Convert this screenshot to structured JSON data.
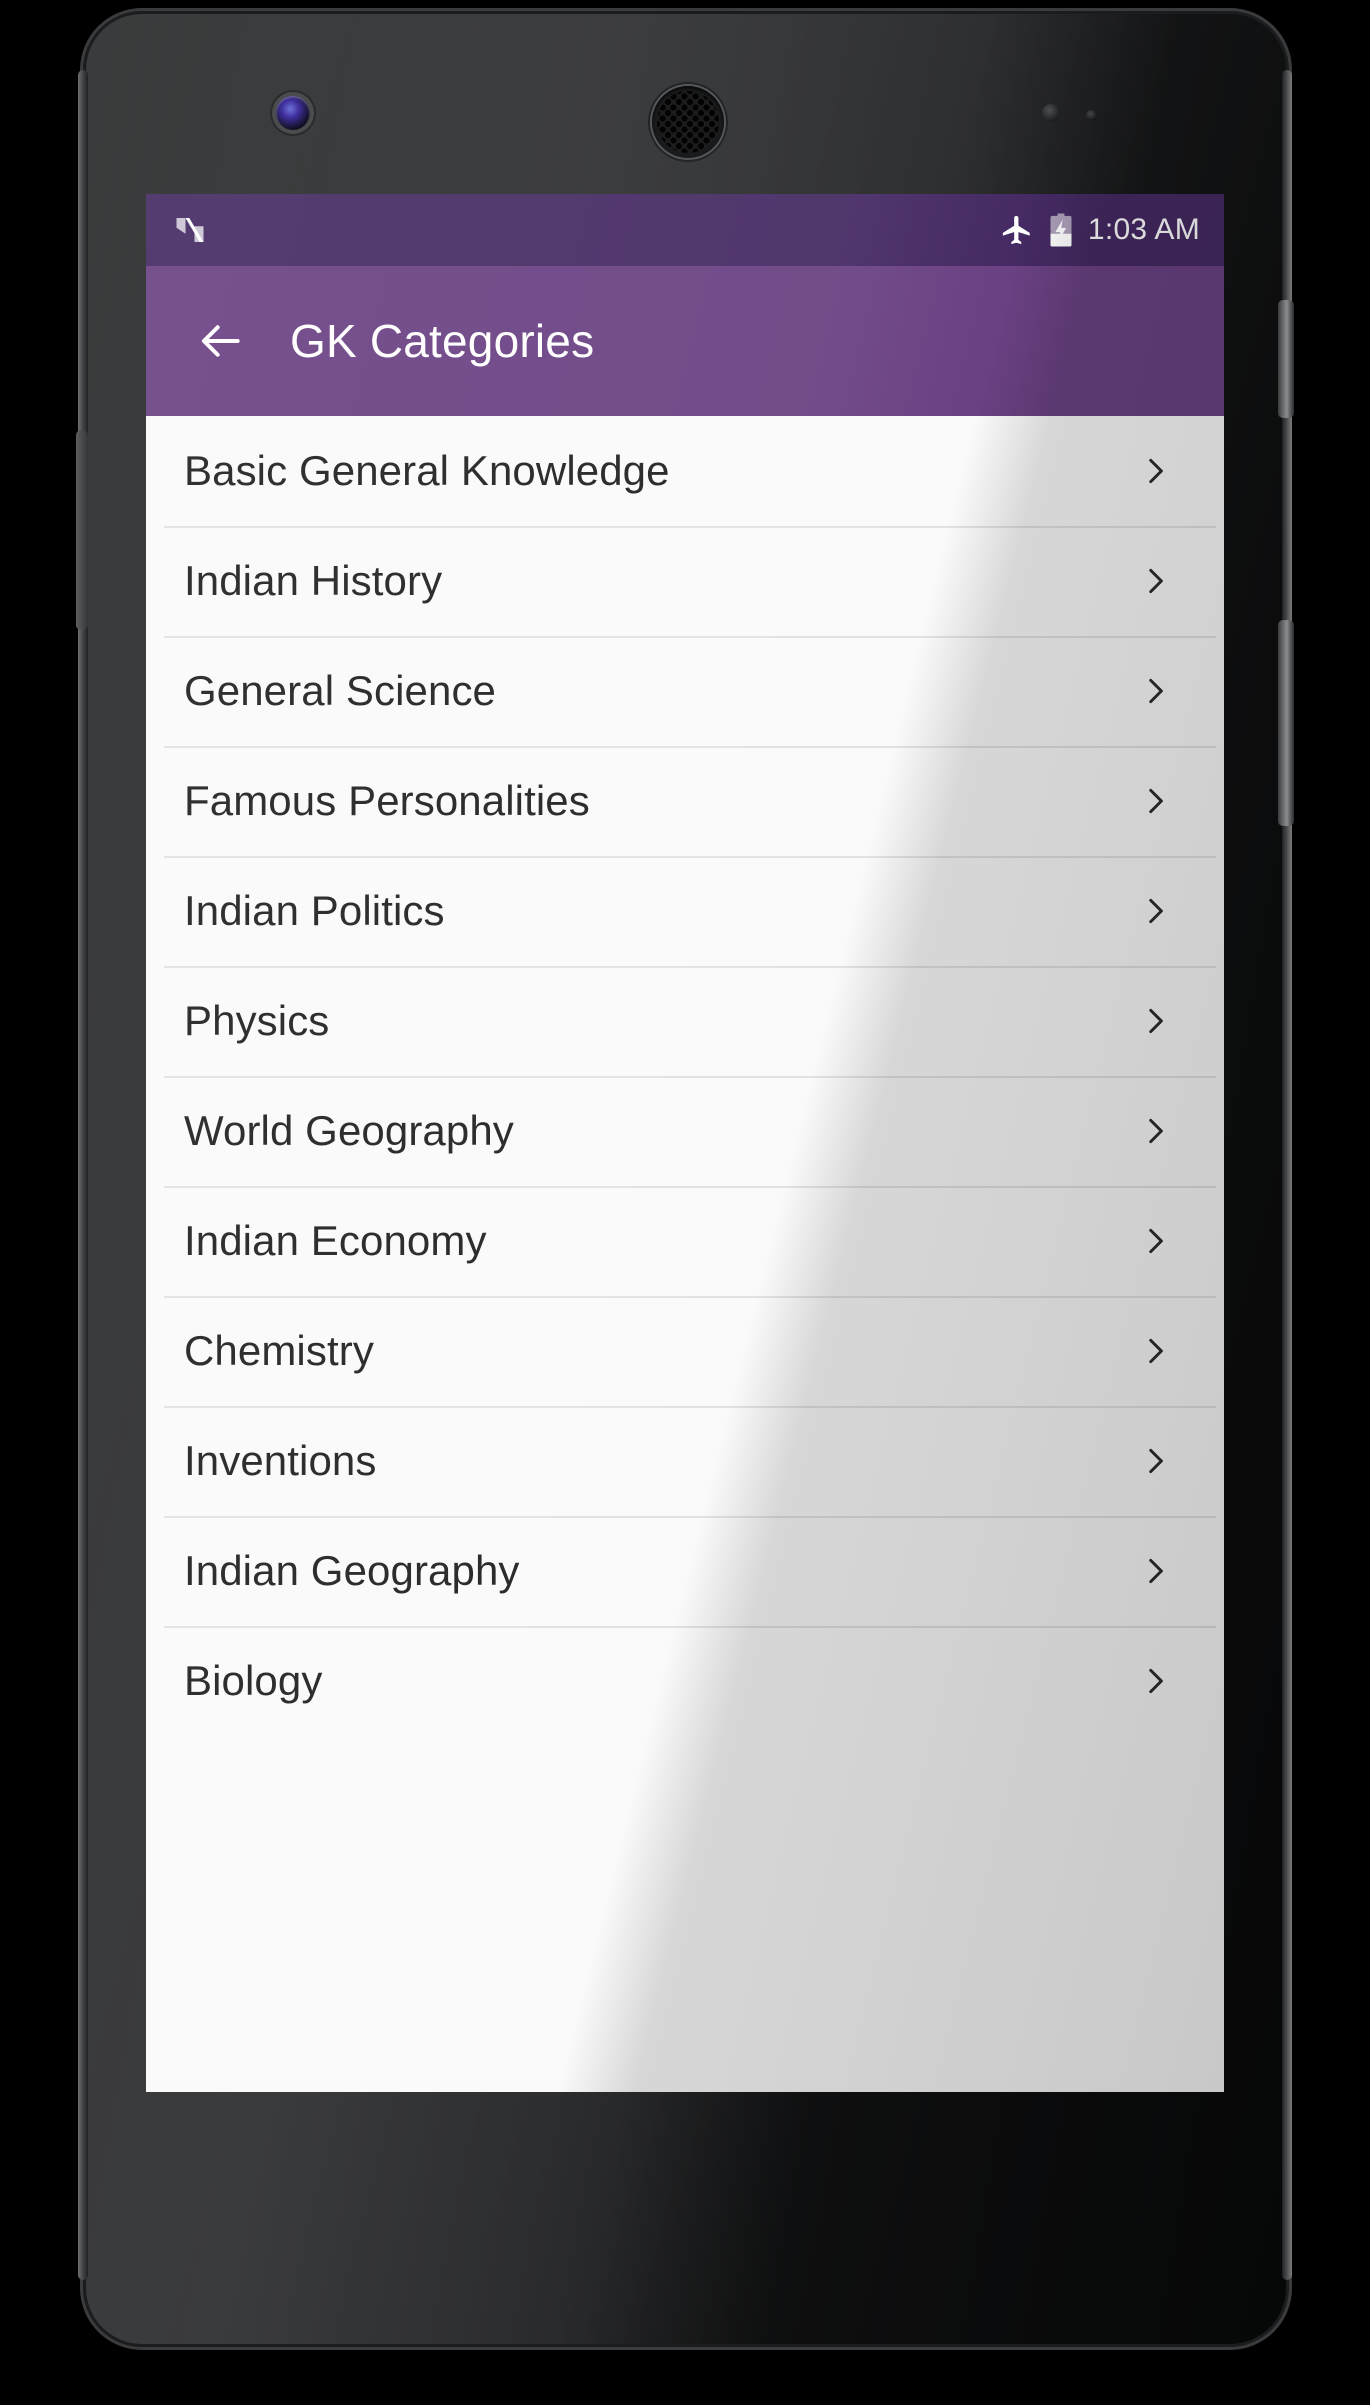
{
  "device": {
    "type": "android-phone-mockup",
    "hardware": {
      "front_camera": "front-camera",
      "earpiece": "earpiece-speaker",
      "power_key": "power-button",
      "volume_key": "volume-button"
    }
  },
  "status_bar": {
    "background_color": "#452a63",
    "os_logo_icon": "android-nougat-n-icon",
    "icons": [
      {
        "name": "airplane-mode-icon",
        "label": "Airplane mode"
      },
      {
        "name": "battery-charging-icon",
        "label": "Battery charging"
      }
    ],
    "time": "1:03 AM"
  },
  "app_bar": {
    "background_color": "#6a4183",
    "back_icon": "back-arrow-icon",
    "title": "GK Categories"
  },
  "main": {
    "background_color": "#fafafa",
    "chevron_icon": "chevron-right-icon",
    "categories": [
      {
        "label": "Basic General Knowledge"
      },
      {
        "label": "Indian History"
      },
      {
        "label": "General Science"
      },
      {
        "label": "Famous Personalities"
      },
      {
        "label": "Indian Politics"
      },
      {
        "label": "Physics"
      },
      {
        "label": "World Geography"
      },
      {
        "label": "Indian Economy"
      },
      {
        "label": "Chemistry"
      },
      {
        "label": "Inventions"
      },
      {
        "label": "Indian Geography"
      },
      {
        "label": "Biology"
      }
    ]
  },
  "colors": {
    "status_bar": "#452a63",
    "app_bar": "#6a4183",
    "list_background": "#fafafa",
    "divider": "#e2e2e2",
    "text_primary": "#1f1f1f",
    "text_on_primary": "#ffffff"
  }
}
